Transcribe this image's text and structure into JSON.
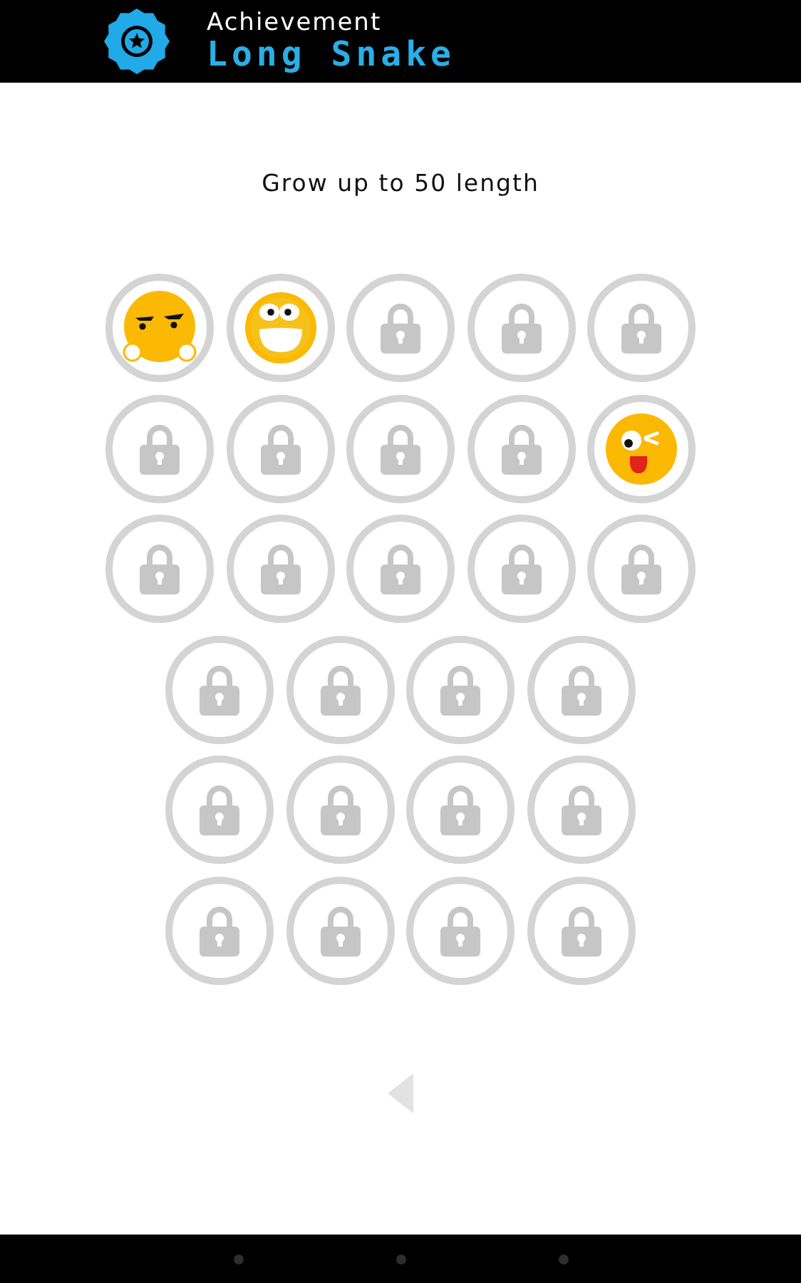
{
  "header": {
    "label": "Achievement",
    "title": "Long Snake"
  },
  "description": "Grow up to 50 length",
  "badge_rows": [
    {
      "badges": [
        {
          "kind": "smug"
        },
        {
          "kind": "grin"
        },
        {
          "kind": "locked"
        },
        {
          "kind": "locked"
        },
        {
          "kind": "locked"
        }
      ]
    },
    {
      "badges": [
        {
          "kind": "locked"
        },
        {
          "kind": "locked"
        },
        {
          "kind": "locked"
        },
        {
          "kind": "locked"
        },
        {
          "kind": "wink"
        }
      ]
    },
    {
      "badges": [
        {
          "kind": "locked"
        },
        {
          "kind": "locked"
        },
        {
          "kind": "locked"
        },
        {
          "kind": "locked"
        },
        {
          "kind": "locked"
        }
      ]
    },
    {
      "badges": [
        {
          "kind": "locked"
        },
        {
          "kind": "locked"
        },
        {
          "kind": "locked"
        },
        {
          "kind": "locked"
        }
      ]
    },
    {
      "badges": [
        {
          "kind": "locked"
        },
        {
          "kind": "locked"
        },
        {
          "kind": "locked"
        },
        {
          "kind": "locked"
        }
      ]
    },
    {
      "badges": [
        {
          "kind": "locked"
        },
        {
          "kind": "locked"
        },
        {
          "kind": "locked"
        },
        {
          "kind": "locked"
        }
      ]
    }
  ]
}
